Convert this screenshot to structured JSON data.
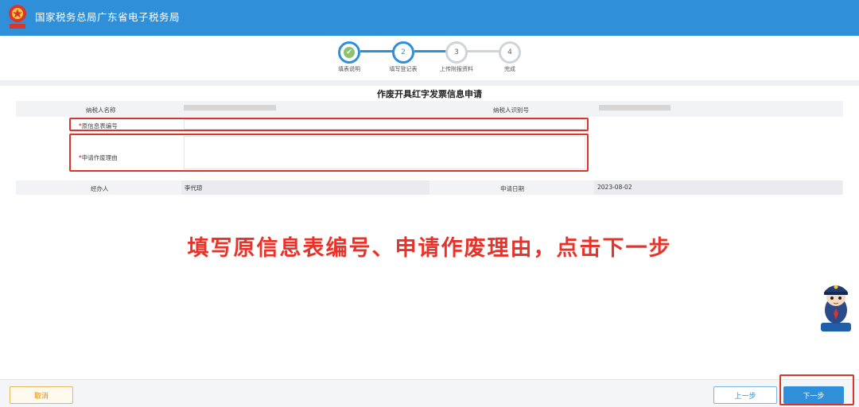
{
  "header": {
    "app_title": "国家税务总局广东省电子税务局",
    "brand_color": "#2f8fd8"
  },
  "stepper": {
    "steps": [
      {
        "number": "✔",
        "label": "填表说明",
        "state": "done"
      },
      {
        "number": "2",
        "label": "填写登记表",
        "state": "current"
      },
      {
        "number": "3",
        "label": "上传附报资料",
        "state": "pending"
      },
      {
        "number": "4",
        "label": "完成",
        "state": "pending"
      }
    ]
  },
  "form": {
    "title": "作废开具红字发票信息申请",
    "taxpayer_name_label": "纳税人名称",
    "taxpayer_id_label": "纳税人识别号",
    "required_mark": "*",
    "original_form_no_label": "原信息表编号",
    "original_form_no_value": "",
    "reason_label": "申请作废理由",
    "reason_value": "",
    "handler_label": "经办人",
    "handler_value": "李代琼",
    "apply_date_label": "申请日期",
    "apply_date_value": "2023-08-02"
  },
  "annotation": {
    "text": "填写原信息表编号、申请作废理由，点击下一步",
    "color": "#e8332a"
  },
  "footer": {
    "cancel_label": "取消",
    "prev_label": "上一步",
    "next_label": "下一步"
  }
}
